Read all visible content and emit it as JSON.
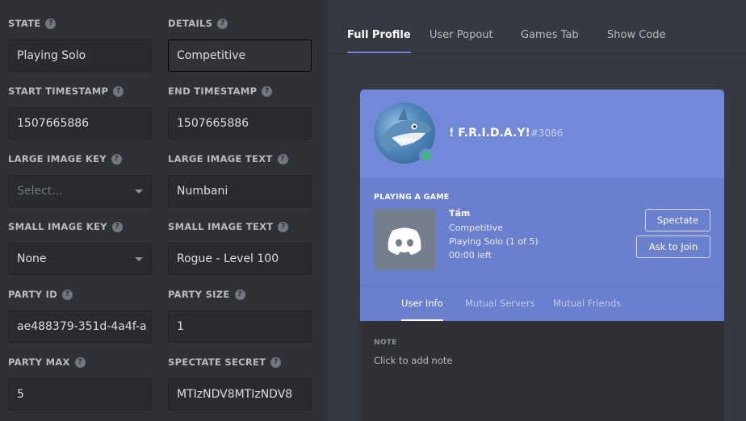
{
  "form": {
    "state": {
      "label": "STATE",
      "value": "Playing Solo"
    },
    "details": {
      "label": "DETAILS",
      "value": "Competitive"
    },
    "start_timestamp": {
      "label": "START TIMESTAMP",
      "value": "1507665886"
    },
    "end_timestamp": {
      "label": "END TIMESTAMP",
      "value": "1507665886"
    },
    "large_image_key": {
      "label": "LARGE IMAGE KEY",
      "placeholder": "Select..."
    },
    "large_image_text": {
      "label": "LARGE IMAGE TEXT",
      "value": "Numbani"
    },
    "small_image_key": {
      "label": "SMALL IMAGE KEY",
      "value": "None"
    },
    "small_image_text": {
      "label": "SMALL IMAGE TEXT",
      "value": "Rogue - Level 100"
    },
    "party_id": {
      "label": "PARTY ID",
      "value": "ae488379-351d-4a4f-a"
    },
    "party_size": {
      "label": "PARTY SIZE",
      "value": "1"
    },
    "party_max": {
      "label": "PARTY MAX",
      "value": "5"
    },
    "spectate_secret": {
      "label": "SPECTATE SECRET",
      "value": "MTIzNDV8MTIzNDV8"
    },
    "help_glyph": "?"
  },
  "tabs": [
    "Full Profile",
    "User Popout",
    "Games Tab",
    "Show Code"
  ],
  "profile": {
    "username": "! F.R.I.D.A.Y!",
    "discriminator": "#3086",
    "status_color": "#43b581",
    "activity": {
      "header": "PLAYING A GAME",
      "game_name": "Tầm",
      "details": "Competitive",
      "state": "Playing Solo (1 of 5)",
      "time_left": "00:00 left",
      "spectate_label": "Spectate",
      "join_label": "Ask to Join"
    },
    "subtabs": [
      "User Info",
      "Mutual Servers",
      "Mutual Friends"
    ],
    "note_label": "NOTE",
    "note_placeholder": "Click to add note"
  },
  "colors": {
    "accent": "#7289da",
    "background": "#2f3136",
    "panel": "#36393f"
  }
}
